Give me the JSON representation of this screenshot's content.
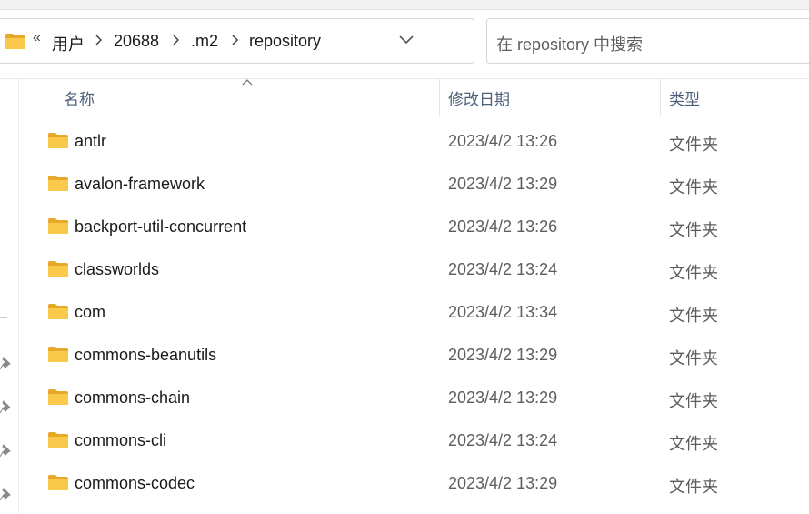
{
  "address_bar": {
    "overflow_glyph": "«",
    "crumbs": [
      "用户",
      "20688",
      ".m2",
      "repository"
    ],
    "dropdown_icon": "chevron-down-icon",
    "refresh_icon": "refresh-icon"
  },
  "search": {
    "placeholder": "在 repository 中搜索"
  },
  "columns": {
    "name": "名称",
    "modified": "修改日期",
    "type": "类型"
  },
  "files": [
    {
      "name": "antlr",
      "modified": "2023/4/2 13:26",
      "type": "文件夹"
    },
    {
      "name": "avalon-framework",
      "modified": "2023/4/2 13:29",
      "type": "文件夹"
    },
    {
      "name": "backport-util-concurrent",
      "modified": "2023/4/2 13:26",
      "type": "文件夹"
    },
    {
      "name": "classworlds",
      "modified": "2023/4/2 13:24",
      "type": "文件夹"
    },
    {
      "name": "com",
      "modified": "2023/4/2 13:34",
      "type": "文件夹"
    },
    {
      "name": "commons-beanutils",
      "modified": "2023/4/2 13:29",
      "type": "文件夹"
    },
    {
      "name": "commons-chain",
      "modified": "2023/4/2 13:29",
      "type": "文件夹"
    },
    {
      "name": "commons-cli",
      "modified": "2023/4/2 13:24",
      "type": "文件夹"
    },
    {
      "name": "commons-codec",
      "modified": "2023/4/2 13:29",
      "type": "文件夹"
    }
  ],
  "colors": {
    "folder": "#f8c94a",
    "folder_dark": "#e8a82a",
    "header_text": "#4c607a"
  }
}
